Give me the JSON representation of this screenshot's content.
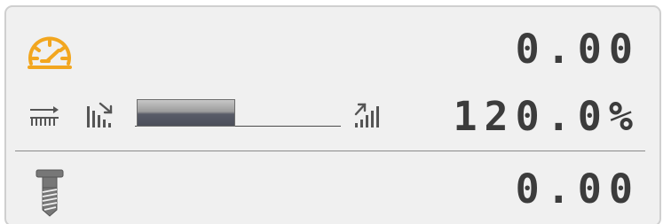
{
  "feed": {
    "icon": "speedometer-icon",
    "value": "0.00",
    "icon_color": "#f2a61f"
  },
  "override": {
    "feed_icon": "feed-rate-icon",
    "decrease_icon": "decrease-override-icon",
    "increase_icon": "increase-override-icon",
    "value": "120.0%",
    "slider_fraction": 0.48
  },
  "spindle": {
    "icon": "spindle-tool-icon",
    "value": "0.00"
  }
}
